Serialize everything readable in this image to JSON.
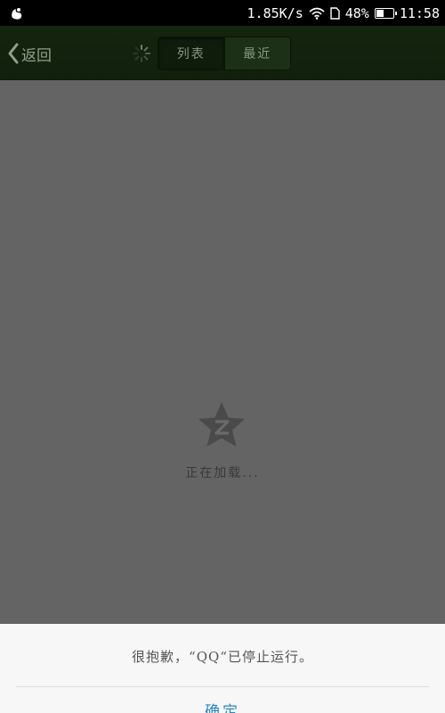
{
  "status_bar": {
    "app_icon": "squirrel-icon",
    "network_speed": "1.85K/s",
    "wifi_icon": "wifi-icon",
    "sim_icon": "sim-card-icon",
    "battery_percent": "48%",
    "battery_level": 0.48,
    "time": "11:58"
  },
  "title_bar": {
    "back_label": "返回",
    "back_icon": "chevron-left-icon",
    "spinner_icon": "loading-spinner-icon",
    "tabs": [
      {
        "label": "列表",
        "active": true
      },
      {
        "label": "最近",
        "active": false
      }
    ]
  },
  "loading": {
    "logo_icon": "qzone-star-icon",
    "text": "正在加载..."
  },
  "dialog": {
    "message": "很抱歉，“QQ“已停止运行。",
    "ok_label": "确定"
  },
  "colors": {
    "status_bar": "#000000",
    "title_bar": "#13230e",
    "overlay": "#646464",
    "dialog_bg": "#f7f7f7",
    "ok_text": "#2a86c6"
  }
}
